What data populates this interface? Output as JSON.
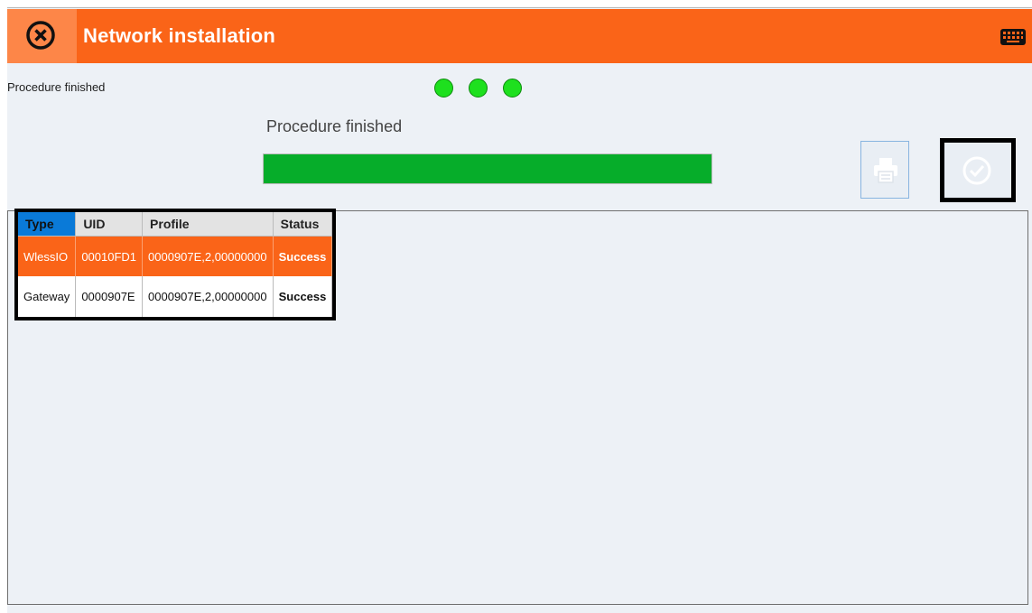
{
  "window": {
    "title": "Network installation"
  },
  "icons": {
    "close": "close-circle-icon",
    "keyboard": "keyboard-icon",
    "print": "printer-icon",
    "confirm": "check-circle-icon"
  },
  "colors": {
    "accent": "#fa6418",
    "status_dot": "#1ee01e",
    "progress": "#06ad2a",
    "selected_header": "#0a7ad8"
  },
  "status": {
    "top_text": "Procedure finished",
    "indicator_count": 3,
    "label": "Procedure finished",
    "progress_fraction": 1.0
  },
  "table": {
    "columns": [
      "Type",
      "UID",
      "Profile",
      "Status"
    ],
    "rows": [
      [
        "WlessIO",
        "00010FD1",
        "0000907E,2,00000000",
        "Success"
      ],
      [
        "Gateway",
        "0000907E",
        "0000907E,2,00000000",
        "Success"
      ]
    ]
  }
}
